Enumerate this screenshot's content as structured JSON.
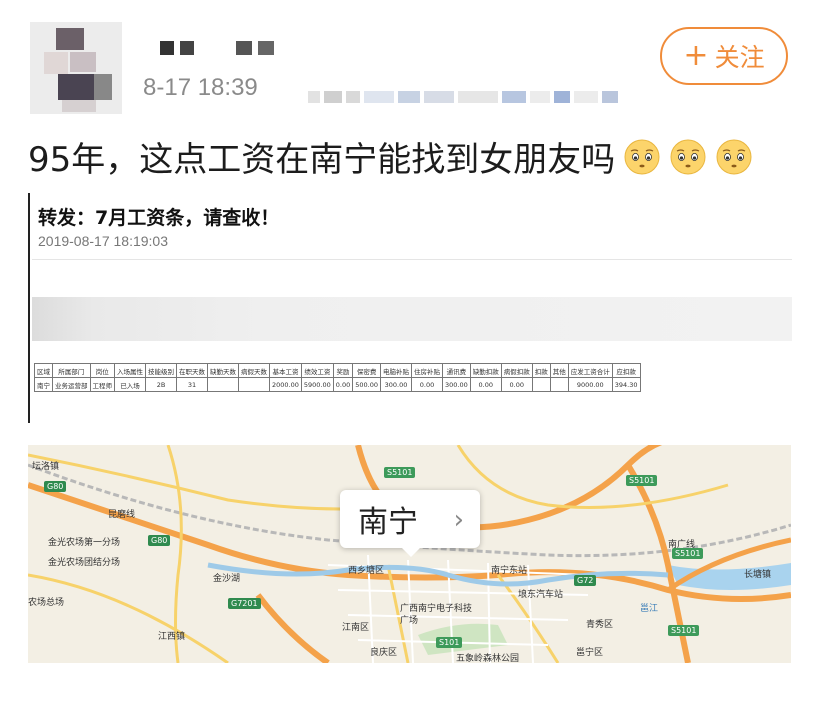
{
  "post": {
    "time": "8-17 18:39",
    "follow_label": "关注",
    "follow_icon": "plus-icon",
    "text": "95年，这点工资在南宁能找到女朋友吗",
    "emoji_count": 3
  },
  "screenshot": {
    "title": "转发：7月工资条，请查收！",
    "date": "2019-08-17 18:19:03",
    "table": {
      "headers": [
        "区域",
        "所属部门",
        "岗位",
        "入场属性",
        "技能级别",
        "在职天数",
        "缺勤天数",
        "病假天数",
        "基本工资",
        "绩效工资",
        "奖励",
        "保密费",
        "电脑补贴",
        "住房补贴",
        "通讯费",
        "缺勤扣款",
        "病假扣款",
        "扣款",
        "其他",
        "应发工资合计",
        "应扣款"
      ],
      "row": [
        "南宁",
        "业务运营部",
        "工程师",
        "已入场",
        "2B",
        "31",
        "",
        "",
        "2000.00",
        "5900.00",
        "0.00",
        "500.00",
        "300.00",
        "0.00",
        "300.00",
        "0.00",
        "0.00",
        "",
        "",
        "9000.00",
        "394.30"
      ]
    }
  },
  "map": {
    "city": "南宁",
    "labels": {
      "l1": "坛洛镇",
      "l2": "金光农场第一分场",
      "l3": "金光农场团结分场",
      "l4": "金沙湖",
      "l5": "农场总场",
      "l6": "江西镇",
      "l7": "西乡塘区",
      "l8": "江南区",
      "l9": "广西南宁电子科技广场",
      "l10": "良庆区",
      "l11": "五象岭森林公园",
      "l12": "南宁东站",
      "l13": "埌东汽车站",
      "l14": "青秀区",
      "l15": "邕宁区",
      "l16": "邕江",
      "l17": "长塘镇",
      "l18": "南广线",
      "l19": "昆磨线"
    },
    "shields": {
      "s1": "S5101",
      "s2": "S5101",
      "s3": "S5101",
      "s4": "S5101",
      "s5": "G80",
      "s6": "G80",
      "s7": "G7201",
      "s8": "S101",
      "s9": "G72"
    }
  }
}
